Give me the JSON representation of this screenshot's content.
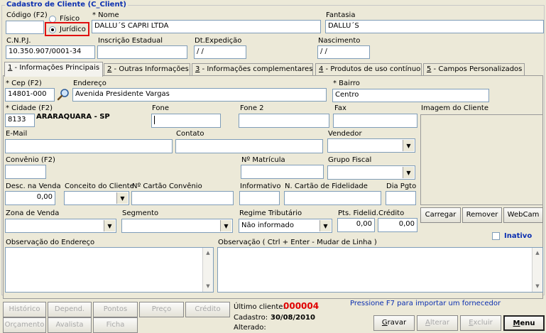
{
  "window": {
    "group_title": "Cadastro de Cliente (C_Client)"
  },
  "header": {
    "codigo_label": "Código (F2)",
    "codigo_value": "",
    "fisico_label": "Físico",
    "juridico_label": "Jurídico",
    "nome_label": "* Nome",
    "nome_value": "DALLU´S CAPRI LTDA",
    "fantasia_label": "Fantasia",
    "fantasia_value": "DALLU´S",
    "cnpj_label": "C.N.P.J.",
    "cnpj_value": "10.350.907/0001-34",
    "ie_label": "Inscrição Estadual",
    "ie_value": "",
    "dtexp_label": "Dt.Expedição",
    "dtexp_value": " / /",
    "nasc_label": "Nascimento",
    "nasc_value": " / /"
  },
  "tabs": [
    {
      "num": "1",
      "label": " - Informações Principais"
    },
    {
      "num": "2",
      "label": " - Outras Informações"
    },
    {
      "num": "3",
      "label": " - Informações complementares"
    },
    {
      "num": "4",
      "label": " - Produtos de uso contínuo"
    },
    {
      "num": "5",
      "label": " - Campos Personalizados"
    }
  ],
  "main": {
    "cep_label": "* Cep (F2)",
    "cep_value": "14801-000",
    "endereco_label": "Endereço",
    "endereco_value": "Avenida Presidente Vargas",
    "bairro_label": "* Bairro",
    "bairro_value": "Centro",
    "cidade_label": "* Cidade (F2)",
    "cidade_code": "8133",
    "cidade_name": "ARARAQUARA - SP",
    "fone_label": "Fone",
    "fone_value": "",
    "fone2_label": "Fone 2",
    "fax_label": "Fax",
    "imagem_label": "Imagem do Cliente",
    "email_label": "E-Mail",
    "contato_label": "Contato",
    "vendedor_label": "Vendedor",
    "convenio_label": "Convênio (F2)",
    "matricula_label": "Nº Matrícula",
    "grupofiscal_label": "Grupo Fiscal",
    "desc_label": "Desc. na Venda",
    "desc_value": "0,00",
    "conceito_label": "Conceito do Cliente",
    "cartaoconv_label": "Nº Cartão Convênio",
    "informativo_label": "Informativo",
    "cartaofid_label": "N. Cartão de Fidelidade",
    "diapgto_label": "Dia Pgto",
    "zona_label": "Zona de Venda",
    "segmento_label": "Segmento",
    "regime_label": "Regime Tributário",
    "regime_value": "Não informado",
    "pts_label": "Pts. Fidelid.",
    "pts_value": "0,00",
    "credito_label": "Crédito",
    "credito_value": "0,00",
    "carregar_label": "Carregar",
    "remover_label": "Remover",
    "webcam_label": "WebCam",
    "inativo_label": "Inativo",
    "obs_end_label": "Observação do Endereço",
    "obs_label": "Observação ( Ctrl + Enter - Mudar de Linha )"
  },
  "footer": {
    "historico": "Histórico",
    "depend": "Depend.",
    "pontos": "Pontos",
    "preco": "Preço",
    "credito": "Crédito",
    "orcamento": "Orçamento",
    "avalista": "Avalista",
    "ficha": "Ficha",
    "ultimo_label": "Último cliente:",
    "ultimo_value": "000004",
    "cadastro_label": "Cadastro:",
    "cadastro_value": "30/08/2010",
    "alterado_label": "Alterado:",
    "f7_hint": "Pressione F7 para importar um fornecedor",
    "gravar": "Gravar",
    "alterar": "Alterar",
    "excluir": "Excluir",
    "menu": "Menu"
  },
  "colors": {
    "title_blue": "#0b2fb0",
    "ultimo_red": "#e00000",
    "highlight_red": "#e01010"
  }
}
